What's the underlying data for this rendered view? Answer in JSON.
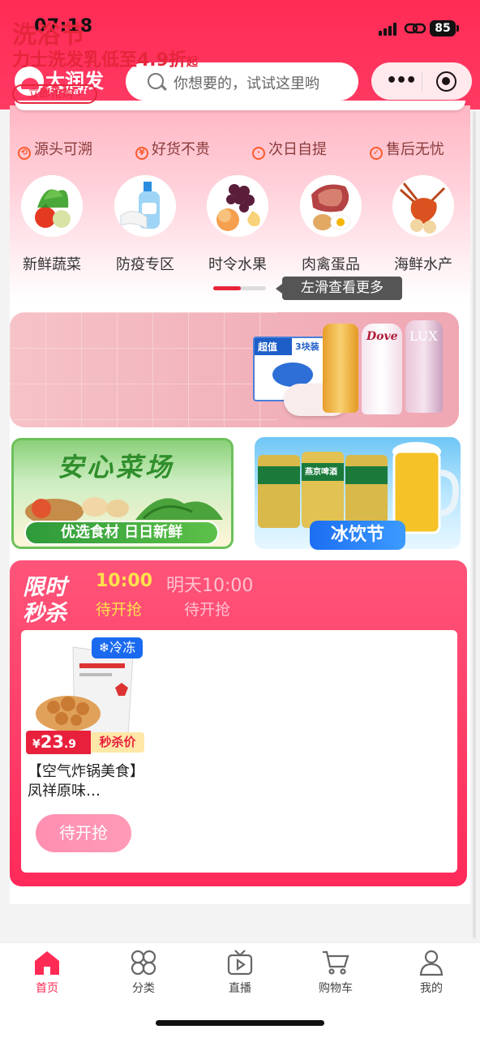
{
  "status_bar": {
    "time": "07:18",
    "battery": "85"
  },
  "header": {
    "logo_text": "大润发",
    "logo_sub": "RT-Mart",
    "search_placeholder": "你想要的，试试这里哟"
  },
  "features": [
    {
      "icon": "trace-icon",
      "label": "源头可溯"
    },
    {
      "icon": "yuan-icon",
      "label": "好货不贵"
    },
    {
      "icon": "clock-icon",
      "label": "次日自提"
    },
    {
      "icon": "shield-icon",
      "label": "售后无忧"
    }
  ],
  "categories": [
    {
      "label": "新鲜蔬菜",
      "icon": "vegetables-image"
    },
    {
      "label": "防疫专区",
      "icon": "sanitizer-image"
    },
    {
      "label": "时令水果",
      "icon": "fruit-image"
    },
    {
      "label": "肉禽蛋品",
      "icon": "meat-egg-image"
    },
    {
      "label": "海鲜水产",
      "icon": "seafood-image"
    }
  ],
  "carousel_progress": 0.52,
  "tooltip": "左滑查看更多",
  "banners": {
    "bath": {
      "title": "洗浴节",
      "subtitle": "力士洗发乳低至4.9折",
      "subtitle_suffix": "起",
      "button": "立即抢购",
      "pack_label": "超值",
      "pack_count": "3块装",
      "brand1": "Dove",
      "brand2": "LUX"
    },
    "veg": {
      "title": "安心菜场",
      "tag": "优选食材 日日新鲜"
    },
    "drink": {
      "tag": "冰饮节",
      "can_label": "燕京啤酒"
    }
  },
  "flash_sale": {
    "title_line1": "限时",
    "title_line2": "秒杀",
    "slots": [
      {
        "time": "10:00",
        "status": "待开抢",
        "active": true
      },
      {
        "time": "明天10:00",
        "status": "待开抢",
        "active": false
      }
    ],
    "product": {
      "tag": "冷冻",
      "price_symbol": "¥",
      "price_int": "23",
      "price_dec": ".9",
      "price_tag": "秒杀价",
      "title": "【空气炸锅美食】凤祥原味…",
      "button": "待开抢"
    }
  },
  "tab_bar": [
    {
      "label": "首页",
      "icon": "home-icon",
      "active": true
    },
    {
      "label": "分类",
      "icon": "category-icon",
      "active": false
    },
    {
      "label": "直播",
      "icon": "live-icon",
      "active": false
    },
    {
      "label": "购物车",
      "icon": "cart-icon",
      "active": false
    },
    {
      "label": "我的",
      "icon": "profile-icon",
      "active": false
    }
  ],
  "colors": {
    "brand": "#ff2b55",
    "accent_red": "#e5253c",
    "tab_active": "#ff2b55"
  }
}
